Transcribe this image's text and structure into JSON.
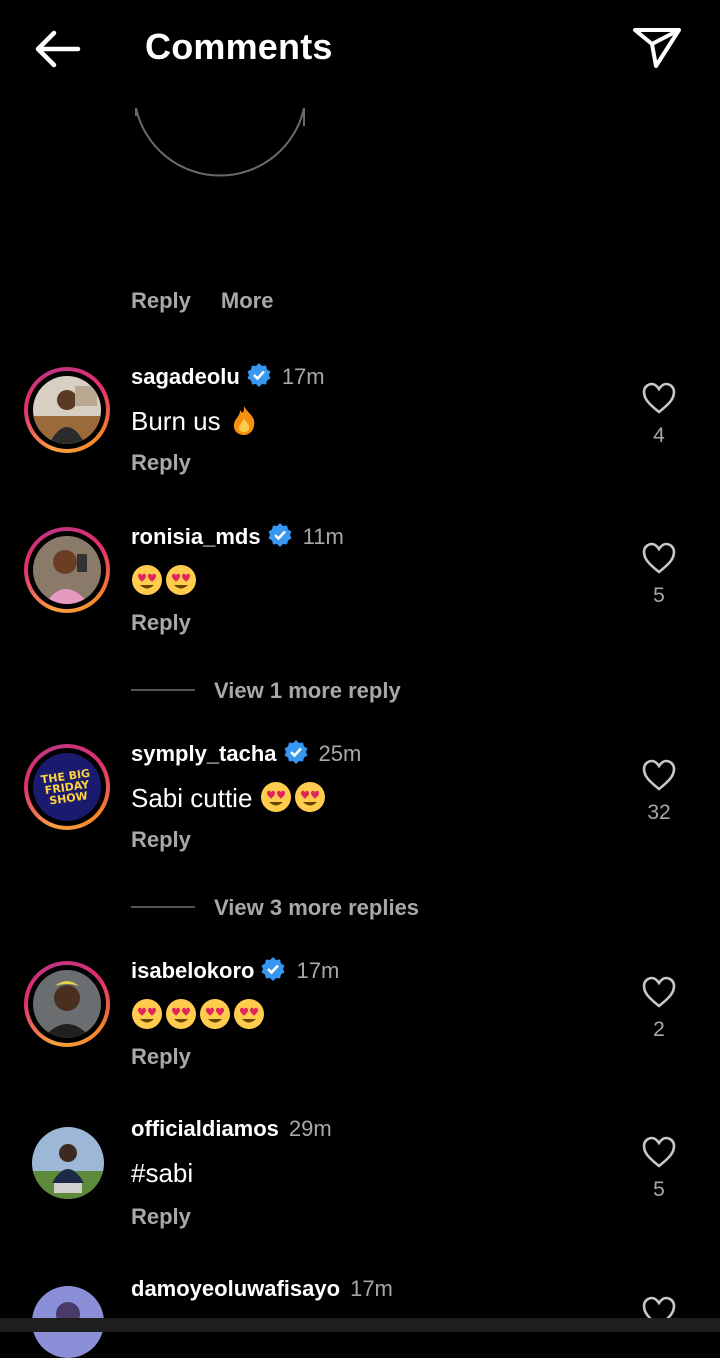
{
  "header": {
    "title": "Comments",
    "back_icon": "arrow-left-icon",
    "share_icon": "paper-plane-icon"
  },
  "previous_actions": {
    "reply": "Reply",
    "more": "More"
  },
  "comments": [
    {
      "username": "sagadeolu",
      "verified": true,
      "time": "17m",
      "text": "Burn us",
      "emojis": [
        "fire"
      ],
      "reply": "Reply",
      "likes": "4",
      "ring": true
    },
    {
      "username": "ronisia_mds",
      "verified": true,
      "time": "11m",
      "text": "",
      "emojis": [
        "heart-eyes",
        "heart-eyes"
      ],
      "reply": "Reply",
      "likes": "5",
      "ring": true,
      "view_more": "View 1 more reply"
    },
    {
      "username": "symply_tacha",
      "verified": true,
      "time": "25m",
      "text": "Sabi cuttie",
      "emojis": [
        "heart-eyes",
        "heart-eyes"
      ],
      "reply": "Reply",
      "likes": "32",
      "ring": true,
      "avatar_text": "THE BIG FRIDAY SHOW",
      "view_more": "View 3 more replies"
    },
    {
      "username": "isabelokoro",
      "verified": true,
      "time": "17m",
      "text": "",
      "emojis": [
        "heart-eyes",
        "heart-eyes",
        "heart-eyes",
        "heart-eyes"
      ],
      "reply": "Reply",
      "likes": "2",
      "ring": true
    },
    {
      "username": "officialdiamos",
      "verified": false,
      "time": "29m",
      "text": "#sabi",
      "emojis": [],
      "reply": "Reply",
      "likes": "5",
      "ring": false
    },
    {
      "username": "damoyeoluwafisayo",
      "verified": false,
      "time": "17m",
      "text": "",
      "emojis": [],
      "reply": "",
      "likes": "",
      "ring": false
    }
  ],
  "colors": {
    "background": "#000000",
    "secondary_text": "#a8a8a8",
    "verified": "#3897f0"
  }
}
